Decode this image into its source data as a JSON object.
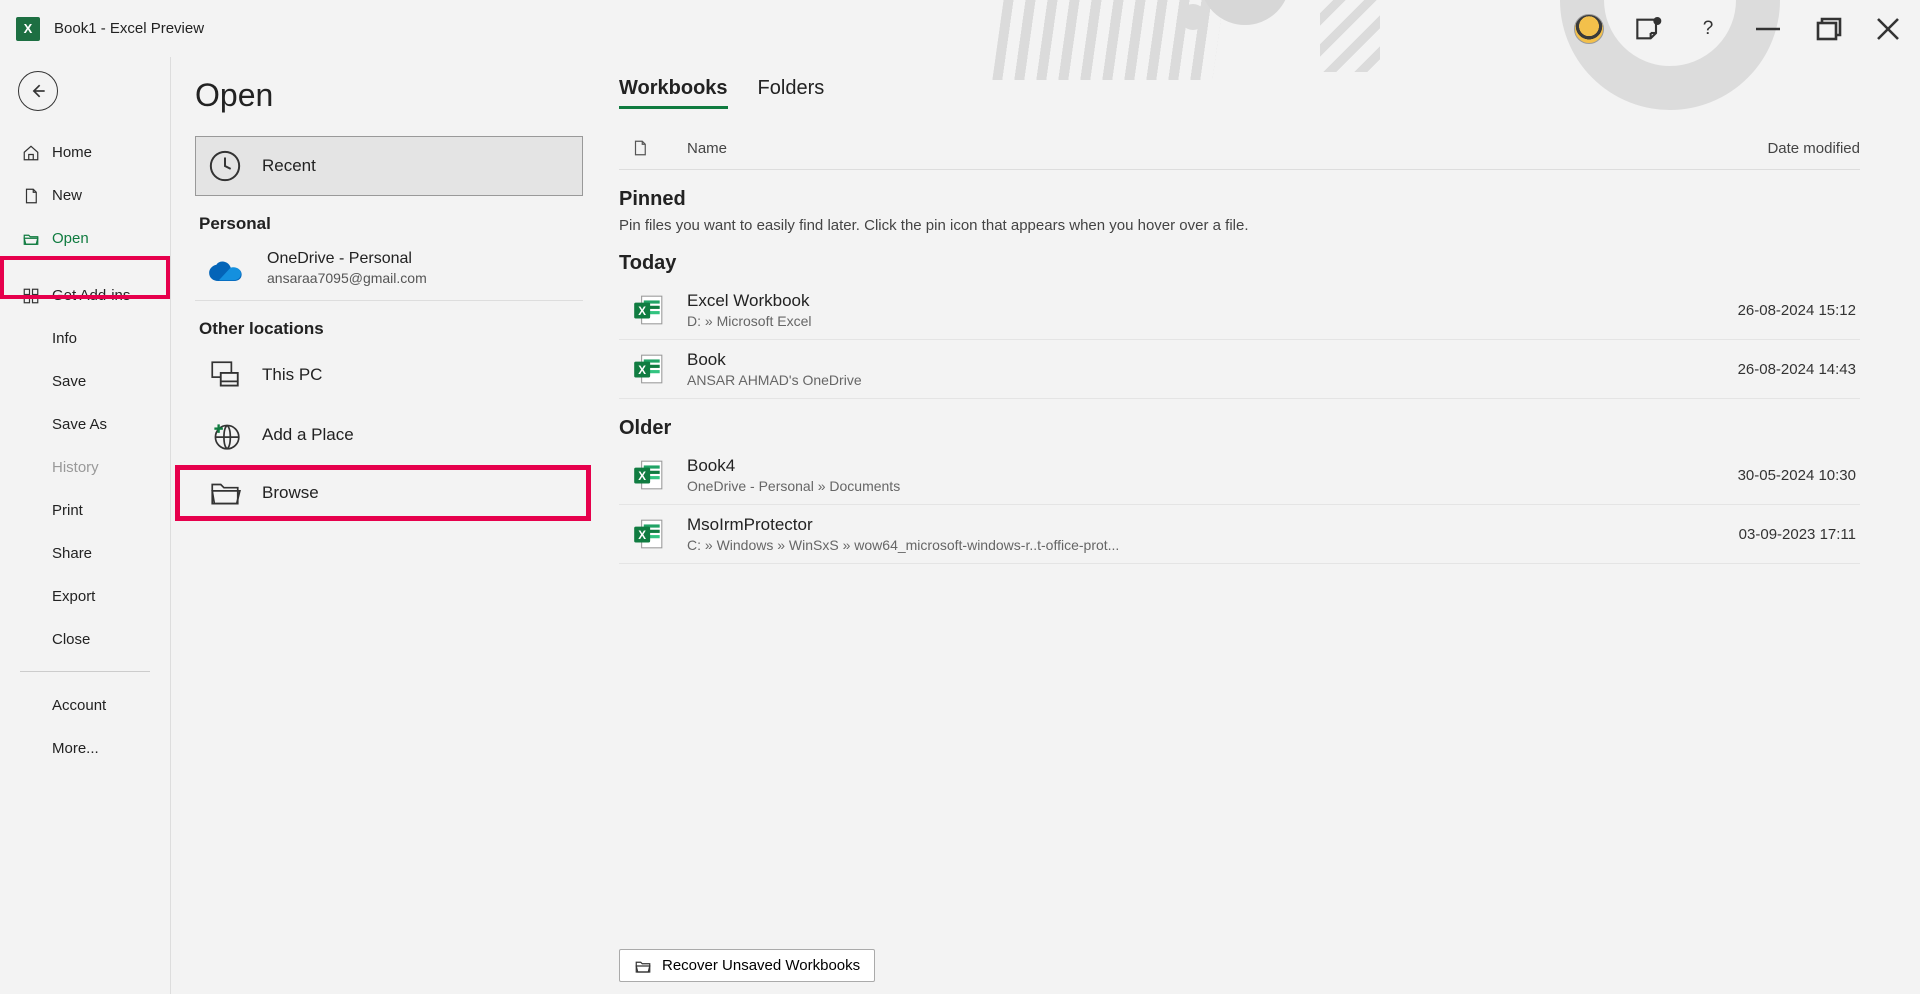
{
  "title": "Book1  -  Excel Preview",
  "sidebar": {
    "home": "Home",
    "new": "New",
    "open": "Open",
    "getaddins": "Get Add-ins",
    "info": "Info",
    "save": "Save",
    "saveas": "Save As",
    "history": "History",
    "print": "Print",
    "share": "Share",
    "export": "Export",
    "close": "Close",
    "account": "Account",
    "more": "More..."
  },
  "page": {
    "title": "Open",
    "recent": "Recent",
    "personal_hdr": "Personal",
    "onedrive_label": "OneDrive - Personal",
    "onedrive_sub": "ansaraa7095@gmail.com",
    "other_hdr": "Other locations",
    "thispc": "This PC",
    "addplace": "Add a Place",
    "browse": "Browse"
  },
  "tabs": {
    "workbooks": "Workbooks",
    "folders": "Folders"
  },
  "cols": {
    "name": "Name",
    "date": "Date modified"
  },
  "groups": {
    "pinned": {
      "title": "Pinned",
      "hint": "Pin files you want to easily find later. Click the pin icon that appears when you hover over a file."
    },
    "today": "Today",
    "older": "Older"
  },
  "files": {
    "today": [
      {
        "name": "Excel Workbook",
        "path": "D: » Microsoft Excel",
        "date": "26-08-2024 15:12"
      },
      {
        "name": "Book",
        "path": "ANSAR AHMAD's OneDrive",
        "date": "26-08-2024 14:43"
      }
    ],
    "older": [
      {
        "name": "Book4",
        "path": "OneDrive - Personal » Documents",
        "date": "30-05-2024 10:30"
      },
      {
        "name": "MsoIrmProtector",
        "path": "C: » Windows » WinSxS » wow64_microsoft-windows-r..t-office-prot...",
        "date": "03-09-2023 17:11"
      }
    ]
  },
  "recover": "Recover Unsaved Workbooks"
}
